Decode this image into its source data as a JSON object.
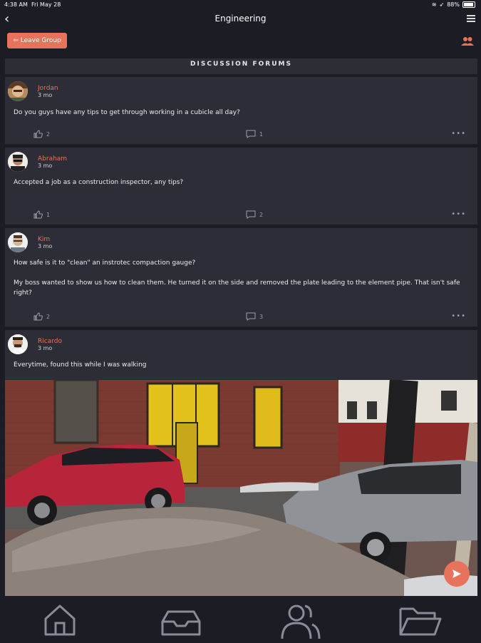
{
  "status_bar": {
    "time": "4:38 AM",
    "date": "Fri May 28",
    "battery": "88%"
  },
  "header": {
    "title": "Engineering"
  },
  "actions": {
    "leave_group": "Leave Group"
  },
  "section": {
    "title": "DISCUSSION FORUMS"
  },
  "posts": [
    {
      "author": "Jordan",
      "time": "3 mo",
      "body": "Do you guys have any tips to get through working in a cubicle all day?",
      "likes": "2",
      "comments": "1"
    },
    {
      "author": "Abraham",
      "time": "3 mo",
      "body": "Accepted a job as a construction inspector, any tips?",
      "likes": "1",
      "comments": "2"
    },
    {
      "author": "Kim",
      "time": "3 mo",
      "body": "How safe is it to \"clean\" an instrotec compaction gauge?",
      "body2": "My boss wanted to show us how to clean them. He turned it on the side and removed the plate leading to the element pipe. That isn't safe right?",
      "likes": "2",
      "comments": "3"
    },
    {
      "author": "Ricardo",
      "time": "3 mo",
      "body": "Everytime, found this while I was walking"
    }
  ],
  "icons": {
    "back": "chevron-left-icon",
    "menu": "hamburger-icon",
    "members": "group-icon",
    "like": "thumbs-up-icon",
    "comment": "comment-icon",
    "more": "ellipsis-icon",
    "send": "send-icon",
    "tabs": [
      "home-icon",
      "inbox-icon",
      "people-icon",
      "folder-icon"
    ]
  },
  "colors": {
    "accent": "#e8735c",
    "background": "#1c1c25",
    "card": "#2d2d38"
  }
}
